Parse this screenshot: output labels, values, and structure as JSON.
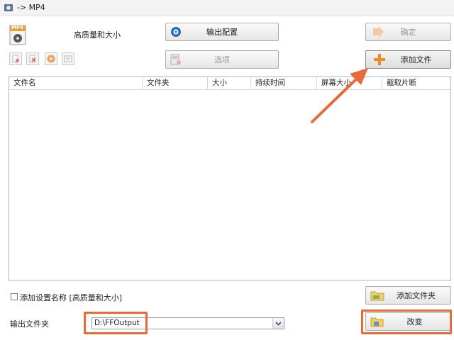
{
  "window": {
    "title": "-> MP4",
    "mp4_badge": "MP4"
  },
  "header": {
    "profile_label": "高质量和大小"
  },
  "buttons": {
    "output_config": "输出配置",
    "options": "选项",
    "ok": "确定",
    "add_file": "添加文件",
    "add_folder": "添加文件夹",
    "change": "改变"
  },
  "toolbar": {
    "icons": [
      "remove-file-icon",
      "delete-icon",
      "play-icon",
      "info-icon"
    ]
  },
  "table": {
    "columns": [
      "文件名",
      "文件夹",
      "大小",
      "持续时间",
      "屏幕大小",
      "截取片断"
    ],
    "rows": []
  },
  "footer": {
    "add_profile_name_label": "添加设置名称 [高质量和大小]",
    "add_profile_name_checked": false,
    "output_folder_label": "输出文件夹",
    "output_folder_value": "D:\\FFOutput"
  },
  "colors": {
    "highlight": "#e86a36",
    "add_icon": "#f28a1e"
  }
}
